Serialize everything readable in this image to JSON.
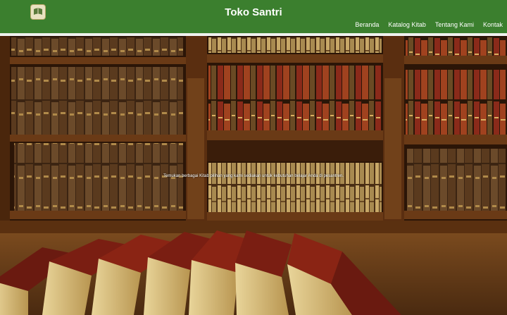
{
  "brand": {
    "title": "Toko Santri",
    "logo": "book-logo-icon"
  },
  "nav": [
    {
      "label": "Beranda"
    },
    {
      "label": "Katalog Kitab"
    },
    {
      "label": "Tentang Kami"
    },
    {
      "label": "Kontak"
    }
  ],
  "hero": {
    "text": "Temukan berbagai Kitab pilihan yang kami sediakan untuk kebutuhan belajar Anda di pesantren.",
    "image": "library-bookshelf-background"
  },
  "colors": {
    "navbar": "#3b7f2e",
    "accent": "#ffffff"
  }
}
